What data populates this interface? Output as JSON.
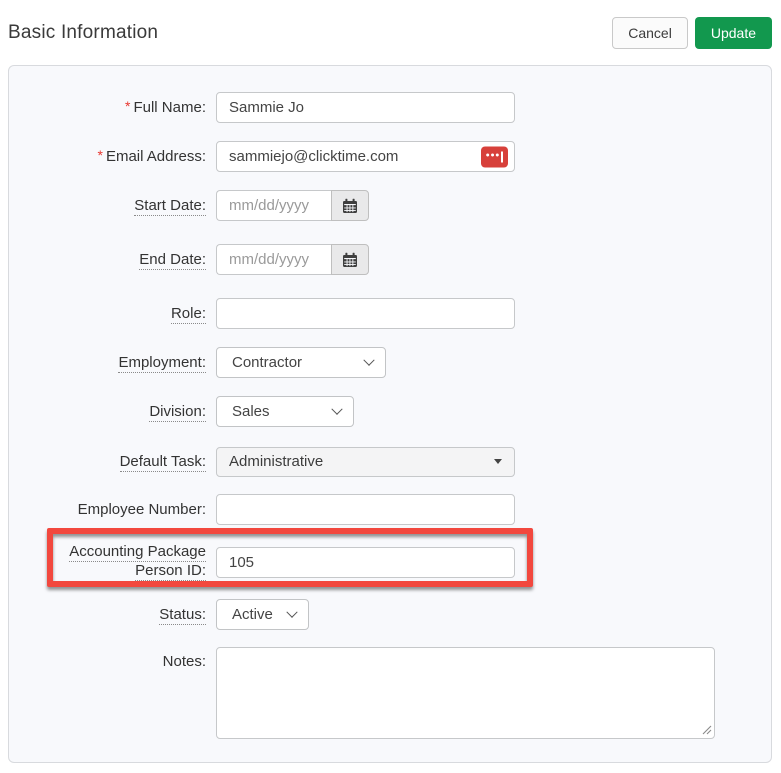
{
  "header": {
    "title": "Basic Information",
    "cancel_label": "Cancel",
    "update_label": "Update"
  },
  "required_marker": "*",
  "fields": {
    "full_name": {
      "label": "Full Name:",
      "required": true,
      "value": "Sammie Jo"
    },
    "email": {
      "label": "Email Address:",
      "required": true,
      "value": "sammiejo@clicktime.com"
    },
    "start_date": {
      "label": "Start Date:",
      "placeholder": "mm/dd/yyyy"
    },
    "end_date": {
      "label": "End Date:",
      "placeholder": "mm/dd/yyyy"
    },
    "role": {
      "label": "Role:",
      "value": ""
    },
    "employment": {
      "label": "Employment:",
      "value": "Contractor"
    },
    "division": {
      "label": "Division:",
      "value": "Sales"
    },
    "default_task": {
      "label": "Default Task:",
      "value": "Administrative"
    },
    "employee_number": {
      "label": "Employee Number:",
      "value": ""
    },
    "accounting_package": {
      "label_line1": "Accounting Package",
      "label_line2": "Person ID:",
      "value": "105"
    },
    "status": {
      "label": "Status:",
      "value": "Active"
    },
    "notes": {
      "label": "Notes:",
      "value": ""
    }
  },
  "icons": {
    "calendar": "calendar-icon",
    "chevron": "chevron-down-icon",
    "caret": "caret-down-icon",
    "password_manager": "password-manager-icon",
    "dots_glyph": "•••"
  },
  "colors": {
    "update_green": "#12984e",
    "annotation_red": "#f2483e",
    "required_red": "#e8352e",
    "password_icon_red": "#d7403a",
    "panel_bg": "#f8f9fc"
  }
}
